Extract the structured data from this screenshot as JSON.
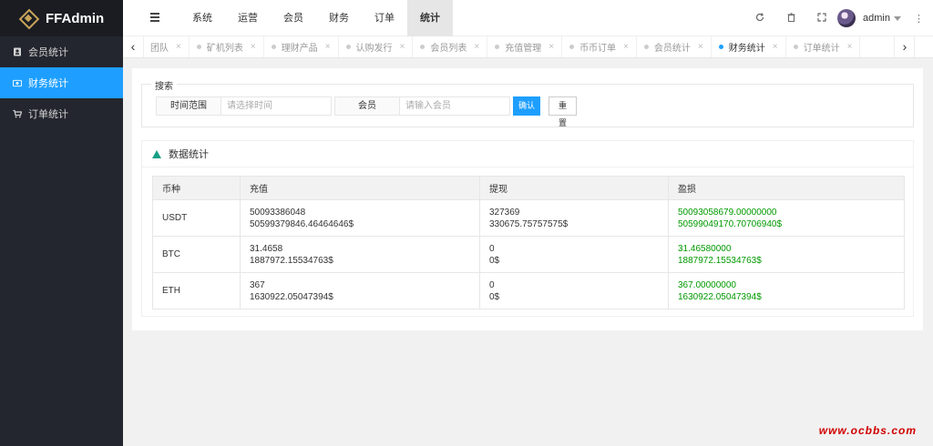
{
  "logo": {
    "text": "FFAdmin"
  },
  "sidebar": {
    "items": [
      {
        "label": "会员统计",
        "icon": "contact-icon"
      },
      {
        "label": "财务统计",
        "icon": "money-icon"
      },
      {
        "label": "订单统计",
        "icon": "cart-icon"
      }
    ]
  },
  "header": {
    "nav": [
      "系统",
      "运营",
      "会员",
      "财务",
      "订单",
      "统计"
    ],
    "active_nav": "统计",
    "user": "admin"
  },
  "tabs": [
    "团队",
    "矿机列表",
    "理财产品",
    "认购发行",
    "会员列表",
    "充值管理",
    "币币订单",
    "会员统计",
    "财务统计",
    "订单统计"
  ],
  "active_tab": "财务统计",
  "search": {
    "legend": "搜索",
    "time_label": "时间范围",
    "time_placeholder": "请选择时间",
    "member_label": "会员",
    "member_placeholder": "请输入会员",
    "confirm": "确认",
    "reset": "重置"
  },
  "stats": {
    "title": "数据统计",
    "columns": [
      "币种",
      "充值",
      "提现",
      "盈损"
    ],
    "rows": [
      {
        "coin": "USDT",
        "deposit": [
          "50093386048",
          "50599379846.46464646$"
        ],
        "withdraw": [
          "327369",
          "330675.75757575$"
        ],
        "profit": [
          "50093058679.00000000",
          "50599049170.70706940$"
        ]
      },
      {
        "coin": "BTC",
        "deposit": [
          "31.4658",
          "1887972.15534763$"
        ],
        "withdraw": [
          "0",
          "0$"
        ],
        "profit": [
          "31.46580000",
          "1887972.15534763$"
        ]
      },
      {
        "coin": "ETH",
        "deposit": [
          "367",
          "1630922.05047394$"
        ],
        "withdraw": [
          "0",
          "0$"
        ],
        "profit": [
          "367.00000000",
          "1630922.05047394$"
        ]
      }
    ]
  },
  "watermark": "www.ocbbs.com",
  "colors": {
    "accent": "#1e9fff",
    "sidebar": "#23262e",
    "profit": "#009900"
  }
}
